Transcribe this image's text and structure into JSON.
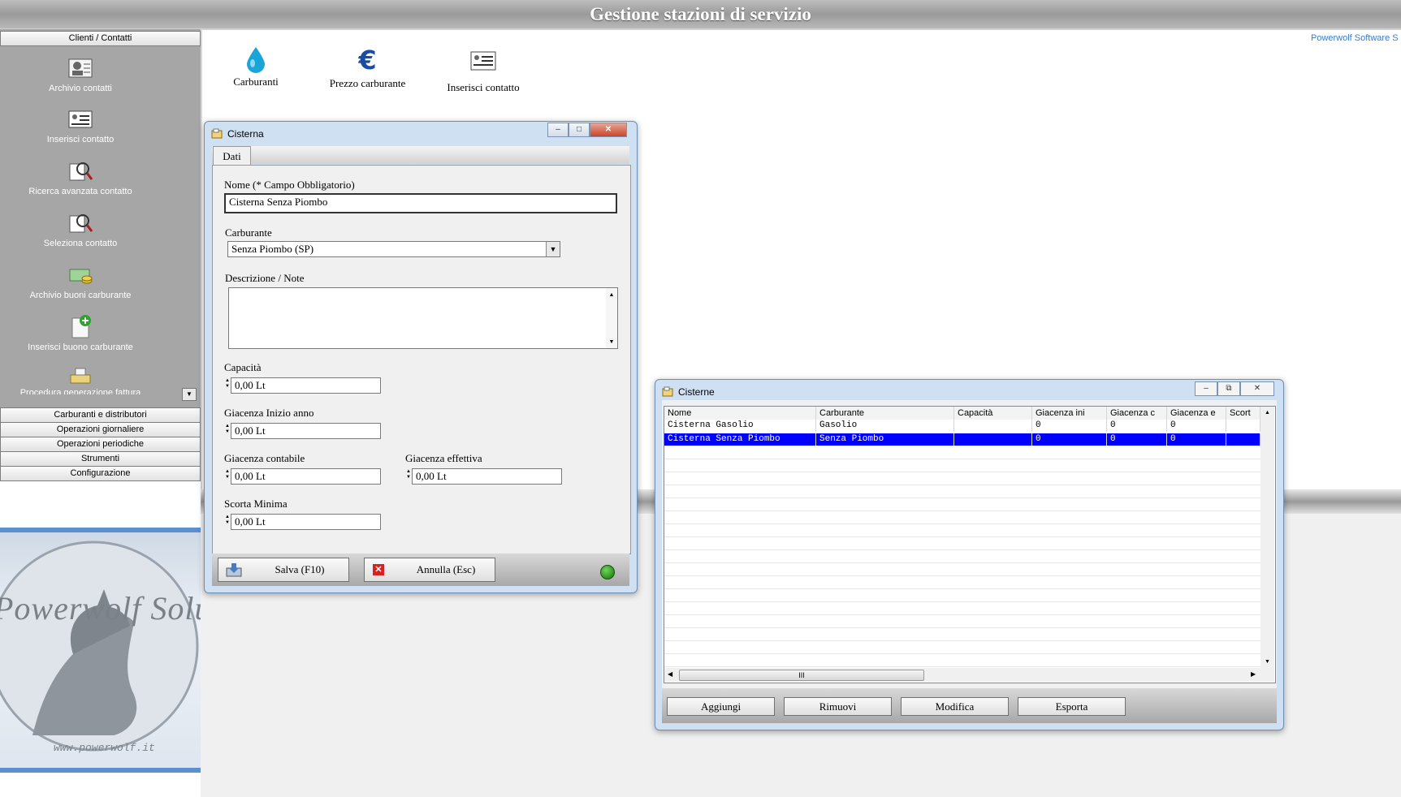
{
  "app": {
    "title": "Gestione stazioni di servizio",
    "vendor_link": "Powerwolf Software S"
  },
  "sidebar": {
    "header": "Clienti / Contatti",
    "items": [
      {
        "label": "Archivio contatti",
        "icon": "contacts-archive-icon"
      },
      {
        "label": "Inserisci contatto",
        "icon": "contact-card-icon"
      },
      {
        "label": "Ricerca avanzata contatto",
        "icon": "search-contact-icon"
      },
      {
        "label": "Seleziona contatto",
        "icon": "select-contact-icon"
      },
      {
        "label": "Archivio buoni carburante",
        "icon": "voucher-archive-icon"
      },
      {
        "label": "Inserisci buono carburante",
        "icon": "add-voucher-icon"
      },
      {
        "label": "Procedura generazione fattura",
        "icon": "invoice-icon"
      }
    ],
    "sections": [
      "Carburanti e distributori",
      "Operazioni giornaliere",
      "Operazioni periodiche",
      "Strumenti",
      "Configurazione"
    ],
    "logo_text": "Powerwolf Solutions",
    "logo_url": "www.powerwolf.it"
  },
  "toolbar": {
    "items": [
      {
        "label": "Carburanti",
        "icon": "drop-icon"
      },
      {
        "label": "Prezzo carburante",
        "icon": "euro-icon"
      },
      {
        "label": "Inserisci contatto",
        "icon": "contact-card-icon"
      }
    ]
  },
  "cisterna_window": {
    "title": "Cisterna",
    "tab": "Dati",
    "nome_label": "Nome (* Campo Obbligatorio)",
    "nome_value": "Cisterna Senza Piombo",
    "carburante_label": "Carburante",
    "carburante_value": "Senza Piombo (SP)",
    "descrizione_label": "Descrizione / Note",
    "descrizione_value": "",
    "capacita_label": "Capacità",
    "capacita_value": "0,00 Lt",
    "giacenza_inizio_label": "Giacenza Inizio anno",
    "giacenza_inizio_value": "0,00 Lt",
    "giacenza_contabile_label": "Giacenza contabile",
    "giacenza_contabile_value": "0,00 Lt",
    "giacenza_effettiva_label": "Giacenza effettiva",
    "giacenza_effettiva_value": "0,00 Lt",
    "scorta_label": "Scorta Minima",
    "scorta_value": "0,00 Lt",
    "save_label": "Salva (F10)",
    "cancel_label": "Annulla (Esc)",
    "status_color": "#2f8f1f"
  },
  "cisterne_window": {
    "title": "Cisterne",
    "columns": [
      "Nome",
      "Carburante",
      "Capacità",
      "Giacenza ini",
      "Giacenza c",
      "Giacenza e",
      "Scort"
    ],
    "rows": [
      [
        "Cisterna Gasolio",
        "Gasolio",
        "",
        "0",
        "0",
        "0",
        ""
      ],
      [
        "Cisterna Senza Piombo",
        "Senza Piombo",
        "",
        "0",
        "0",
        "0",
        ""
      ]
    ],
    "selected_row": 1,
    "scroll_thumb": "III",
    "buttons": {
      "add": "Aggiungi",
      "remove": "Rimuovi",
      "edit": "Modifica",
      "export": "Esporta"
    }
  },
  "colors": {
    "selection": "#0000ff",
    "sidebar_bg": "#a6a6a6",
    "accent_blue": "#3a7cc9"
  }
}
